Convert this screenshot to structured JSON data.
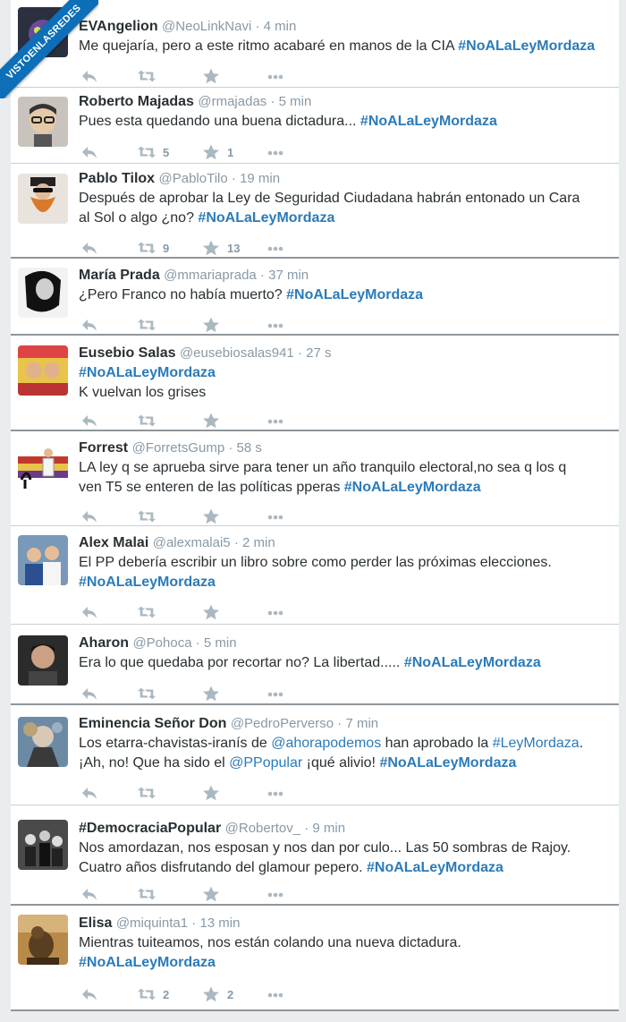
{
  "watermark": "VISTOENLASREDES",
  "tweets": [
    {
      "name": "EVAngelion",
      "handle": "@NeoLinkNavi",
      "time": "4 min",
      "lines": [
        [
          {
            "t": "Me quejaría, pero a este ritmo acabaré en manos de la CIA "
          },
          {
            "t": "#NoALaLeyMordaza",
            "k": "tag"
          }
        ]
      ],
      "retweets": "",
      "favorites": ""
    },
    {
      "name": "Roberto Majadas",
      "handle": "@rmajadas",
      "time": "5 min",
      "lines": [
        [
          {
            "t": "Pues esta quedando una buena dictadura... "
          },
          {
            "t": "#NoALaLeyMordaza",
            "k": "tag"
          }
        ]
      ],
      "retweets": "5",
      "favorites": "1"
    },
    {
      "name": "Pablo Tilox",
      "handle": "@PabloTilo",
      "time": "19 min",
      "lines": [
        [
          {
            "t": "Después de aprobar la Ley de Seguridad Ciudadana habrán entonado un Cara"
          }
        ],
        [
          {
            "t": "al Sol o algo ¿no? "
          },
          {
            "t": "#NoALaLeyMordaza",
            "k": "tag"
          }
        ]
      ],
      "retweets": "9",
      "favorites": "13"
    },
    {
      "name": "María Prada",
      "handle": "@mmariaprada",
      "time": "37 min",
      "lines": [
        [
          {
            "t": "¿Pero Franco no había muerto? "
          },
          {
            "t": "#NoALaLeyMordaza",
            "k": "tag"
          }
        ]
      ],
      "retweets": "",
      "favorites": ""
    },
    {
      "name": "Eusebio Salas",
      "handle": "@eusebiosalas941",
      "time": "27 s",
      "lines": [
        [
          {
            "t": "#NoALaLeyMordaza",
            "k": "tag"
          }
        ],
        [
          {
            "t": "K vuelvan los grises"
          }
        ]
      ],
      "retweets": "",
      "favorites": ""
    },
    {
      "name": "Forrest",
      "handle": "@ForretsGump",
      "time": "58 s",
      "lines": [
        [
          {
            "t": "LA ley q  se aprueba sirve para tener un año tranquilo electoral,no sea q los q"
          }
        ],
        [
          {
            "t": "ven T5 se enteren de las políticas pperas "
          },
          {
            "t": "#NoALaLeyMordaza",
            "k": "tag"
          }
        ]
      ],
      "retweets": "",
      "favorites": ""
    },
    {
      "name": "Alex Malai",
      "handle": "@alexmalai5",
      "time": "2 min",
      "lines": [
        [
          {
            "t": "El PP debería escribir un libro sobre como perder las próximas elecciones."
          }
        ],
        [
          {
            "t": "#NoALaLeyMordaza",
            "k": "tag"
          }
        ]
      ],
      "retweets": "",
      "favorites": ""
    },
    {
      "name": "Aharon",
      "handle": "@Pohoca",
      "time": "5 min",
      "lines": [
        [
          {
            "t": "Era lo que quedaba por recortar no? La libertad..... "
          },
          {
            "t": "#NoALaLeyMordaza",
            "k": "tag"
          }
        ]
      ],
      "retweets": "",
      "favorites": ""
    },
    {
      "name": "Eminencia Señor Don",
      "handle": "@PedroPerverso",
      "time": "7 min",
      "lines": [
        [
          {
            "t": "Los etarra-chavistas-iranís de "
          },
          {
            "t": "@ahorapodemos",
            "k": "mention"
          },
          {
            "t": " han aprobado la "
          },
          {
            "t": "#LeyMordaza",
            "k": "mention"
          },
          {
            "t": "."
          }
        ],
        [
          {
            "t": "¡Ah, no! Que ha sido el "
          },
          {
            "t": "@PPopular",
            "k": "mention"
          },
          {
            "t": " ¡qué alivio! "
          },
          {
            "t": "#NoALaLeyMordaza",
            "k": "tag"
          }
        ]
      ],
      "retweets": "",
      "favorites": ""
    },
    {
      "name": "#DemocraciaPopular",
      "handle": "@Robertov_",
      "time": "9 min",
      "lines": [
        [
          {
            "t": "Nos amordazan, nos esposan y nos dan por culo... Las 50 sombras de Rajoy."
          }
        ],
        [
          {
            "t": "Cuatro años disfrutando del glamour pepero. "
          },
          {
            "t": "#NoALaLeyMordaza",
            "k": "tag"
          }
        ]
      ],
      "retweets": "",
      "favorites": ""
    },
    {
      "name": "Elisa",
      "handle": "@miquinta1",
      "time": "13 min",
      "lines": [
        [
          {
            "t": "Mientras tuiteamos, nos están colando una nueva dictadura."
          }
        ],
        [
          {
            "t": "#NoALaLeyMordaza",
            "k": "tag"
          }
        ]
      ],
      "retweets": "2",
      "favorites": "2"
    }
  ],
  "icons": {
    "reply": "reply-icon",
    "retweet": "retweet-icon",
    "favorite": "star-icon",
    "more": "more-icon"
  },
  "colors": {
    "hashtag": "#2b7bb9",
    "name": "#292f33",
    "meta": "#8899a6",
    "action": "#aab8c2",
    "watermark": "#0c6fb8"
  }
}
